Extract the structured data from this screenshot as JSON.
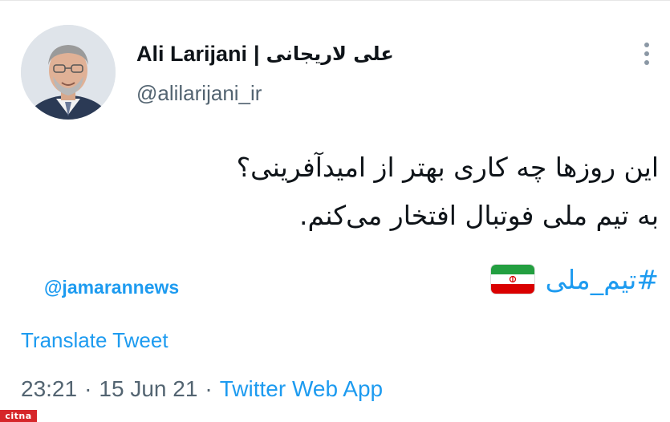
{
  "author": {
    "display_name": "Ali Larijani",
    "separator": "|",
    "display_name_fa": "علی لاریجانی",
    "handle": "@alilarijani_ir"
  },
  "icons": {
    "avatar": "profile-photo",
    "more": "more-vertical-icon",
    "flag": "iran-flag-icon"
  },
  "tweet": {
    "line1": "این روزها چه کاری بهتر از امیدآفرینی؟",
    "line2": "به تیم ملی فوتبال افتخار می‌کنم.",
    "hashtag": "#تیم_ملی",
    "mention": "@jamarannews"
  },
  "translate_label": "Translate Tweet",
  "meta": {
    "time": "23:21",
    "date": "15 Jun 21",
    "dot": "·",
    "source": "Twitter Web App"
  },
  "watermark": "citna",
  "colors": {
    "link": "#1d9bf0",
    "muted": "#536471",
    "text": "#0f1419",
    "watermark_bg": "#d6262a"
  }
}
